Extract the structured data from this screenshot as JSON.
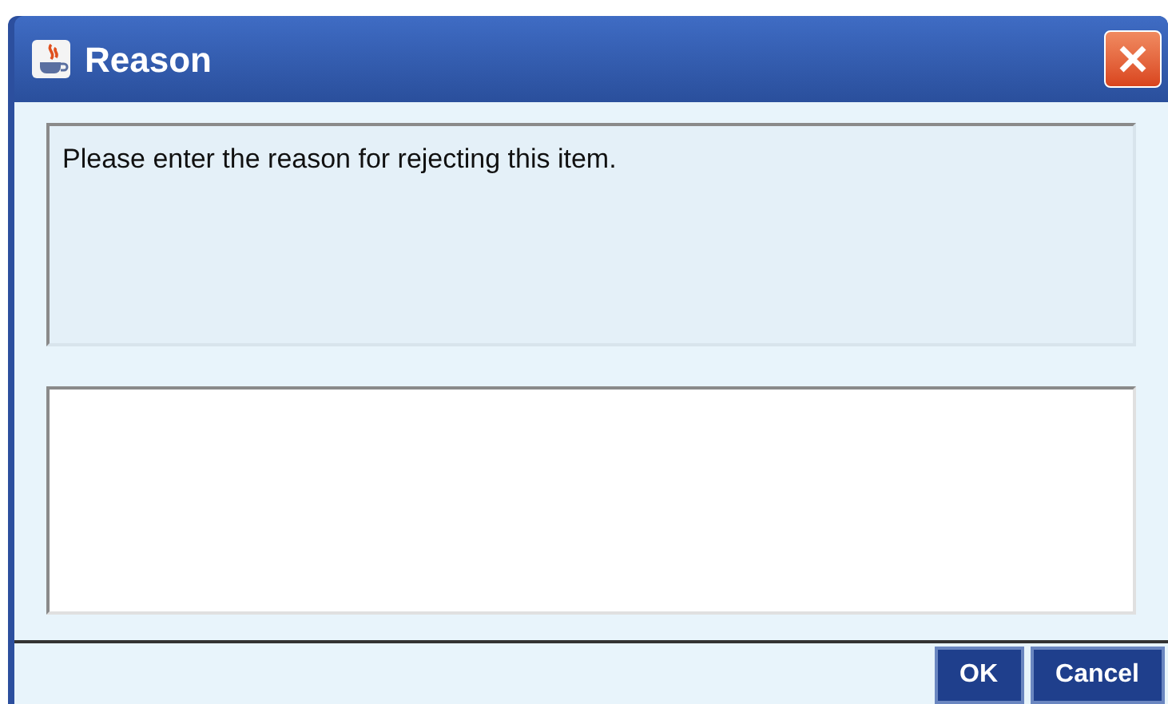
{
  "window": {
    "title": "Reason"
  },
  "message": "Please enter the reason for rejecting this item.",
  "buttons": [
    "OK",
    "Cancel"
  ]
}
